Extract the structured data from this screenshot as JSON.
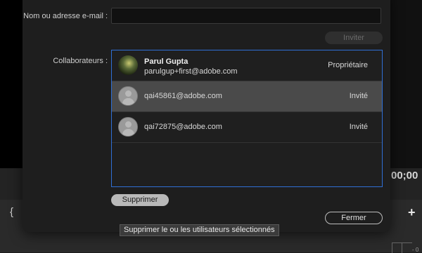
{
  "background": {
    "timecode_fragment": "00;00",
    "brace_glyph": "{",
    "add_glyph": "+",
    "ruler_value": "- 0"
  },
  "dialog": {
    "subtitle": "… … …",
    "email_label": "Nom ou adresse e-mail :",
    "email_value": "",
    "email_placeholder": "",
    "invite_label": "Inviter",
    "collaborators_label": "Collaborateurs :",
    "collaborators": [
      {
        "name": "Parul Gupta",
        "email": "parulgup+first@adobe.com",
        "role": "Propriétaire",
        "avatar": "photo",
        "selected": false
      },
      {
        "name": "",
        "email": "qai45861@adobe.com",
        "role": "Invité",
        "avatar": "default-user-icon",
        "selected": true
      },
      {
        "name": "",
        "email": "qai72875@adobe.com",
        "role": "Invité",
        "avatar": "default-user-icon",
        "selected": false
      }
    ],
    "delete_label": "Supprimer",
    "tooltip": "Supprimer le ou les utilisateurs sélectionnés",
    "close_label": "Fermer"
  },
  "colors": {
    "list_border_accent": "#2f6fd6",
    "selected_row": "#4a4a4a"
  }
}
